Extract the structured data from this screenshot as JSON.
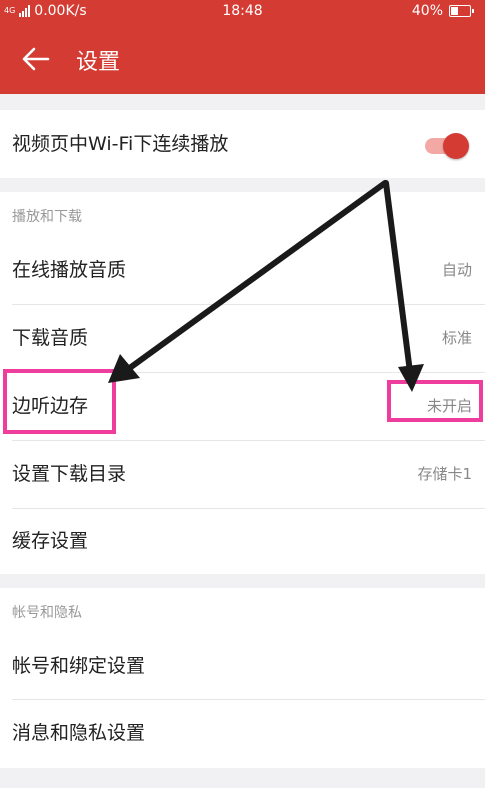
{
  "status_bar": {
    "network_type": "4G",
    "speed": "0.00K/s",
    "time": "18:48",
    "battery": "40%"
  },
  "header": {
    "title": "设置",
    "back_icon": "arrow-left-icon"
  },
  "video_section": {
    "autoplay_label": "视频页中Wi-Fi下连续播放",
    "autoplay_enabled": true
  },
  "playback_section": {
    "header": "播放和下载",
    "items": [
      {
        "label": "在线播放音质",
        "value": "自动"
      },
      {
        "label": "下载音质",
        "value": "标准"
      },
      {
        "label": "边听边存",
        "value": "未开启"
      },
      {
        "label": "设置下载目录",
        "value": "存储卡1"
      },
      {
        "label": "缓存设置",
        "value": ""
      }
    ]
  },
  "account_section": {
    "header": "帐号和隐私",
    "items": [
      {
        "label": "帐号和绑定设置"
      },
      {
        "label": "消息和隐私设置"
      }
    ]
  },
  "colors": {
    "brand": "#d43b33",
    "highlight": "#ee3d9d",
    "annotation_arrow": "#1a1a1a"
  }
}
